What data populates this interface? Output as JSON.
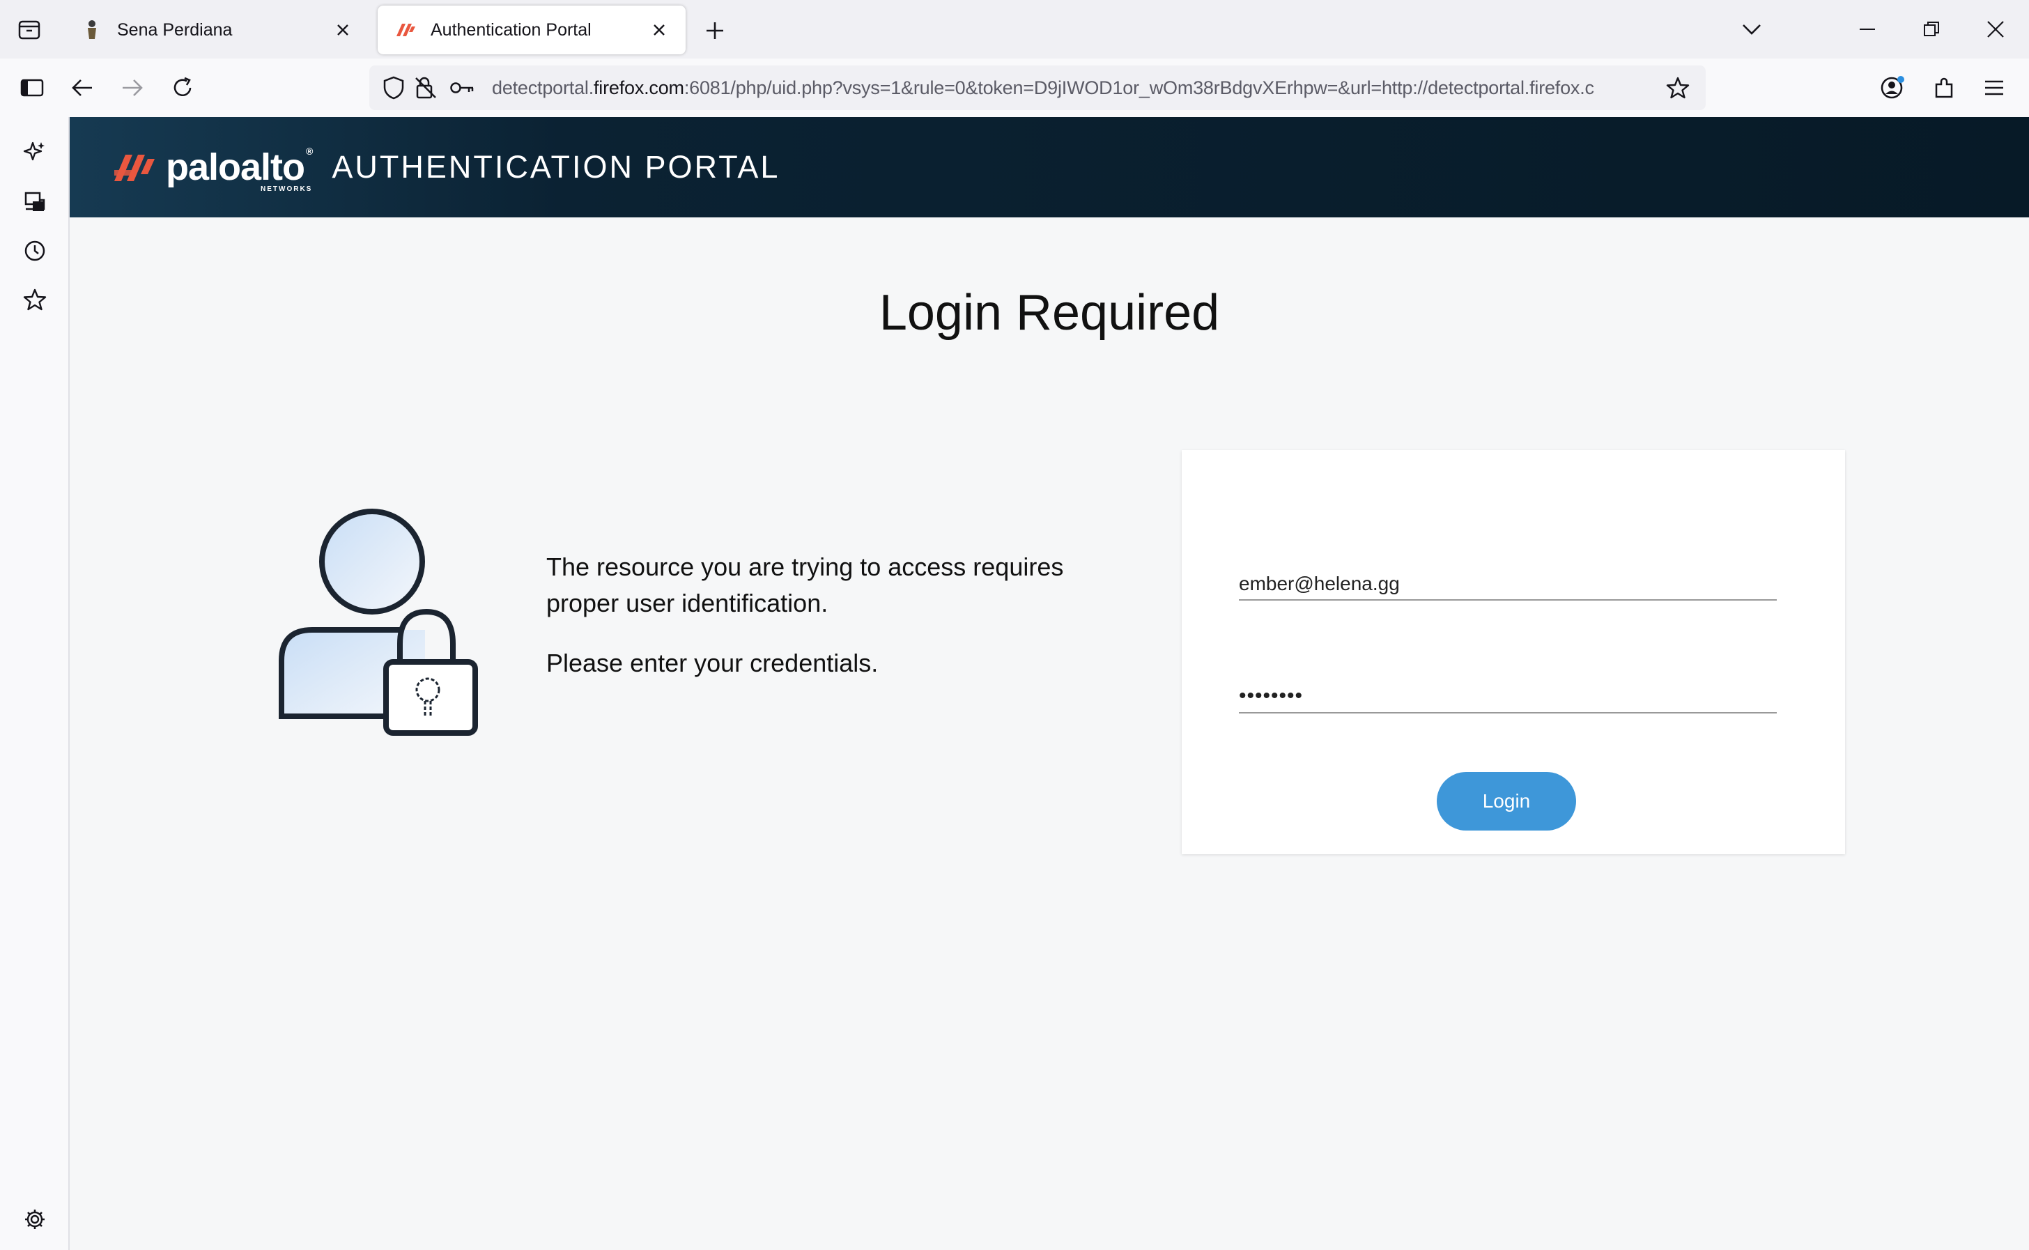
{
  "browser": {
    "tabs": [
      {
        "title": "Sena Perdiana",
        "active": false
      },
      {
        "title": "Authentication Portal",
        "active": true
      }
    ],
    "url": {
      "prefix": "detectportal.",
      "domain": "firefox.com",
      "rest": ":6081/php/uid.php?vsys=1&rule=0&token=D9jIWOD1or_wOm38rBdgvXErhpw=&url=http://detectportal.firefox.c"
    }
  },
  "portal": {
    "brand": {
      "wordmark": "paloalto",
      "sub": "NETWORKS",
      "reg": "®"
    },
    "title": "AUTHENTICATION PORTAL",
    "heading": "Login Required",
    "message_line": "The resource you are trying to access requires proper user identification.",
    "instruction": "Please enter your credentials.",
    "form": {
      "username_value": "ember@helena.gg",
      "password_value": "••••••••",
      "login_label": "Login"
    },
    "colors": {
      "header_bg": "#071a27",
      "accent": "#3e97d9",
      "logo": "#e9573f"
    }
  }
}
